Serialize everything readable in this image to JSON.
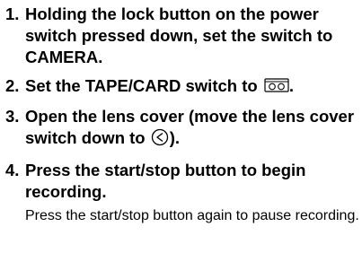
{
  "steps": [
    {
      "number": "1.",
      "text": "Holding the lock button on the power switch pressed down, set the switch to CAMERA."
    },
    {
      "number": "2.",
      "text_before_icon": "Set the TAPE/CARD switch to",
      "icon": "tape-icon",
      "text_after_icon": "."
    },
    {
      "number": "3.",
      "text_before_icon": "Open the lens cover (move the lens cover switch down to",
      "icon": "lens-cover-icon",
      "text_after_icon": ")."
    },
    {
      "number": "4.",
      "text": "Press the start/stop button to begin recording.",
      "note": "Press the start/stop button again to pause recording."
    }
  ]
}
